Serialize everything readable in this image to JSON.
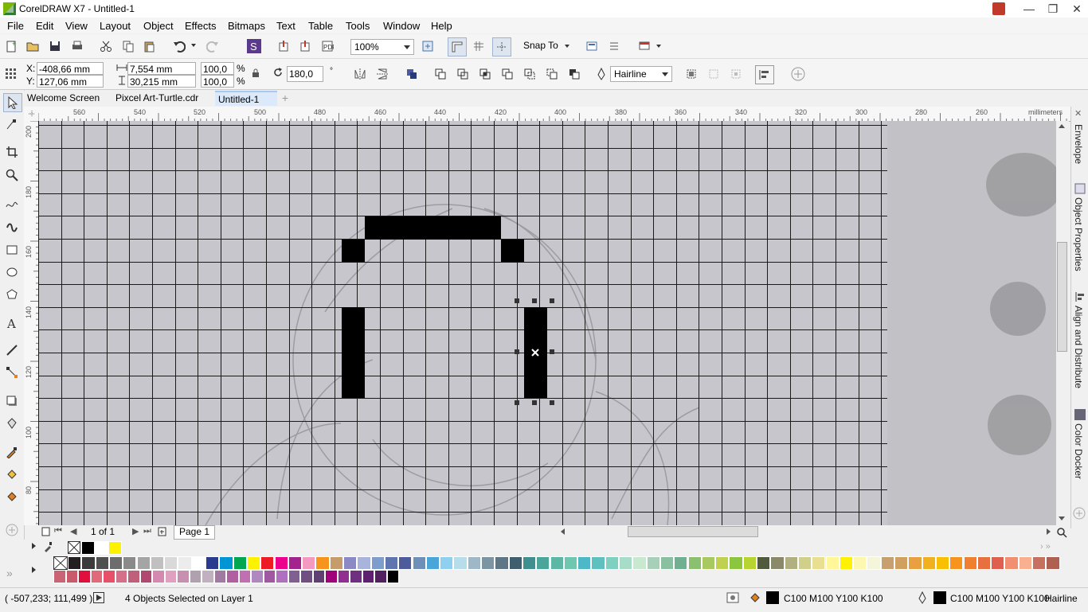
{
  "window": {
    "title": "CorelDRAW X7 - Untitled-1"
  },
  "menu": [
    "File",
    "Edit",
    "View",
    "Layout",
    "Object",
    "Effects",
    "Bitmaps",
    "Text",
    "Table",
    "Tools",
    "Window",
    "Help"
  ],
  "standard_toolbar": {
    "zoom": "100%",
    "snap_to": "Snap To"
  },
  "property_bar": {
    "x_label": "X:",
    "x": "-408,66 mm",
    "y_label": "Y:",
    "y": "127,06 mm",
    "width": "7,554 mm",
    "height": "30,215 mm",
    "scale_w": "100,0",
    "scale_h": "100,0",
    "percent": "%",
    "rotation": "180,0",
    "degree": "°",
    "outline": "Hairline"
  },
  "tabs": [
    "Welcome Screen",
    "Pixcel Art-Turtle.cdr",
    "Untitled-1"
  ],
  "ruler": {
    "h_labels": [
      "560",
      "540",
      "520",
      "500",
      "480",
      "460",
      "440",
      "420",
      "400",
      "380",
      "360",
      "340",
      "320",
      "300",
      "280",
      "260"
    ],
    "h_unit": "millimeters",
    "v_labels": [
      "200",
      "180",
      "160",
      "140",
      "120",
      "100",
      "80"
    ],
    "v_unit": "millimeters"
  },
  "dockers": [
    "Envelope",
    "Object Properties",
    "Align and Distribute",
    "Color Docker"
  ],
  "page_nav": {
    "count": "1 of 1",
    "page_tab": "Page 1"
  },
  "status": {
    "coords": "( -507,233; 111,499 )",
    "selection": "4 Objects Selected on Layer 1",
    "fill": "C100 M100 Y100 K100",
    "outline_color": "C100 M100 Y100 K100",
    "outline_width": "Hairline"
  },
  "palette": {
    "doc_colors": [
      "#000000",
      "#ffffff",
      "#fff200"
    ],
    "row1": [
      "#231f20",
      "#3b3b3b",
      "#505050",
      "#6d6d6d",
      "#8a8a8a",
      "#a5a5a5",
      "#c0c0c0",
      "#d9d9d9",
      "#ececec",
      "#ffffff",
      "#2a3a8f",
      "#0096d6",
      "#00a650",
      "#fff200",
      "#ed1c24",
      "#ec008c",
      "#a3238e",
      "#f49ac1",
      "#f7941d",
      "#c69c6d",
      "#8b8ac4",
      "#a8b4db",
      "#7e9ccc",
      "#5f75b0",
      "#4e5c9c",
      "#6e90b8",
      "#4aa6d8",
      "#8fd0f0",
      "#b7dcea",
      "#9fb8c8",
      "#7b95a5",
      "#5f7785",
      "#3f5f6f",
      "#3f8f8f",
      "#4aa59b",
      "#5cb8a5",
      "#6fc7b0",
      "#4fb8c8",
      "#5fc0c0",
      "#7ed0c0",
      "#a7dcc8",
      "#c8e8d0",
      "#a8d0b8",
      "#88c0a0",
      "#70b090",
      "#8ac070",
      "#a8c860",
      "#c0d050",
      "#8cc63f",
      "#b8d430",
      "#505a3c",
      "#8a8a6a",
      "#b0b080",
      "#d0d08a",
      "#e8e090",
      "#fff799",
      "#fff200",
      "#fcf8b0",
      "#f5f5dc",
      "#c8a070",
      "#d0a060",
      "#e8a040",
      "#f0b020",
      "#f8c000",
      "#f7941d",
      "#f08030",
      "#e87040",
      "#e06050",
      "#f09070",
      "#f8b090",
      "#c87060",
      "#b06050"
    ],
    "row2": [
      "#c86474",
      "#c85a6a",
      "#e0103c",
      "#e06a7a",
      "#e8506a",
      "#d4708a",
      "#c0607a",
      "#b04870",
      "#d48ab0",
      "#e0a0c0",
      "#c890b0",
      "#b0a0b0",
      "#c0b0c0",
      "#a07aa0",
      "#b060a0",
      "#c070b0",
      "#b088c0",
      "#a058a0",
      "#b070c0",
      "#806090",
      "#705080",
      "#604070",
      "#a0007a",
      "#903090",
      "#703080",
      "#602070",
      "#502060",
      "#000000"
    ]
  }
}
